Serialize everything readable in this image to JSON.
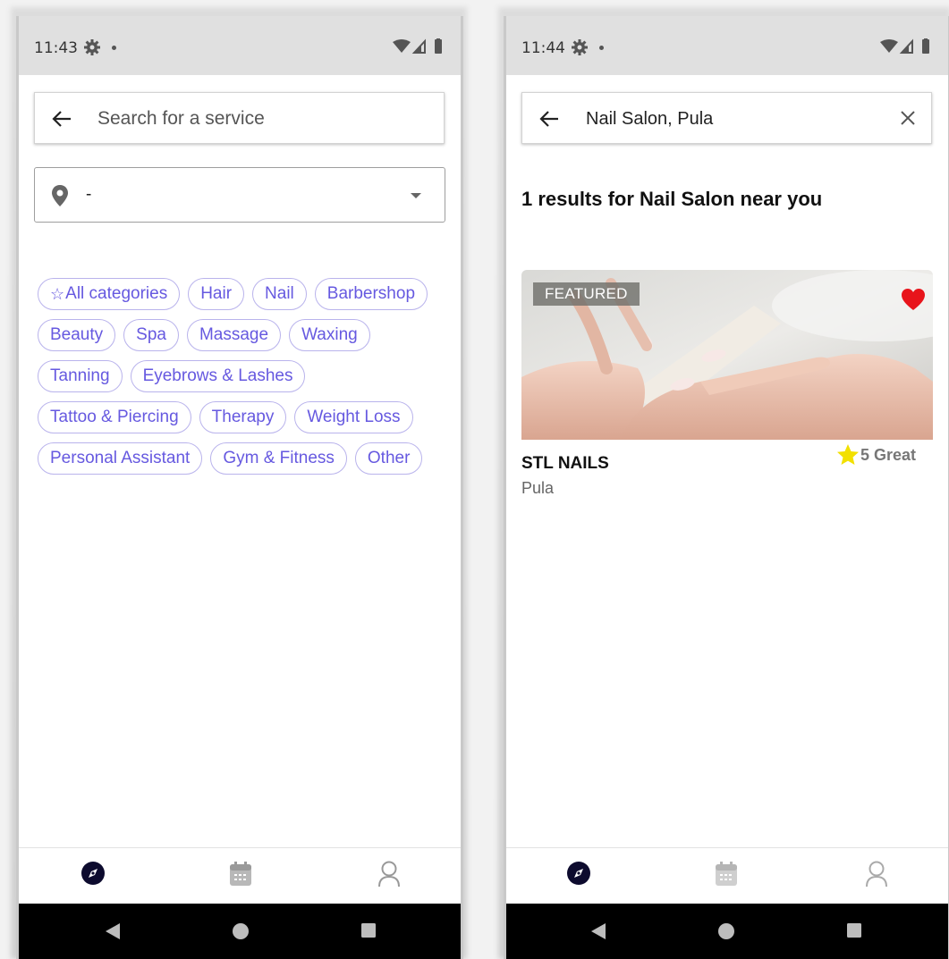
{
  "left_screen": {
    "status": {
      "time": "11:43"
    },
    "search": {
      "placeholder": "Search for a service"
    },
    "location": {
      "value": "-"
    },
    "categories": [
      {
        "label": "All categories",
        "icon": "star-outline-icon"
      },
      {
        "label": "Hair"
      },
      {
        "label": "Nail"
      },
      {
        "label": "Barbershop"
      },
      {
        "label": "Beauty"
      },
      {
        "label": "Spa"
      },
      {
        "label": "Massage"
      },
      {
        "label": "Waxing"
      },
      {
        "label": "Tanning"
      },
      {
        "label": "Eyebrows & Lashes"
      },
      {
        "label": "Tattoo & Piercing"
      },
      {
        "label": "Therapy"
      },
      {
        "label": "Weight Loss"
      },
      {
        "label": "Personal Assistant"
      },
      {
        "label": "Gym & Fitness"
      },
      {
        "label": "Other"
      }
    ]
  },
  "right_screen": {
    "status": {
      "time": "11:44"
    },
    "search": {
      "query": "Nail Salon, Pula"
    },
    "results_title": "1 results for Nail Salon near you",
    "result": {
      "badge": "FEATURED",
      "name": "STL NAILS",
      "city": "Pula",
      "rating": "5 Great",
      "favorited": true
    }
  },
  "bottom_nav": [
    "compass-icon",
    "calendar-icon",
    "profile-icon"
  ],
  "colors": {
    "accent": "#6659e0",
    "chip_border": "#b9b3ec",
    "status_bar": "#e0e0e0",
    "heart": "#e8141b",
    "star": "#f2e000",
    "nav_active": "#0d0b2e"
  }
}
